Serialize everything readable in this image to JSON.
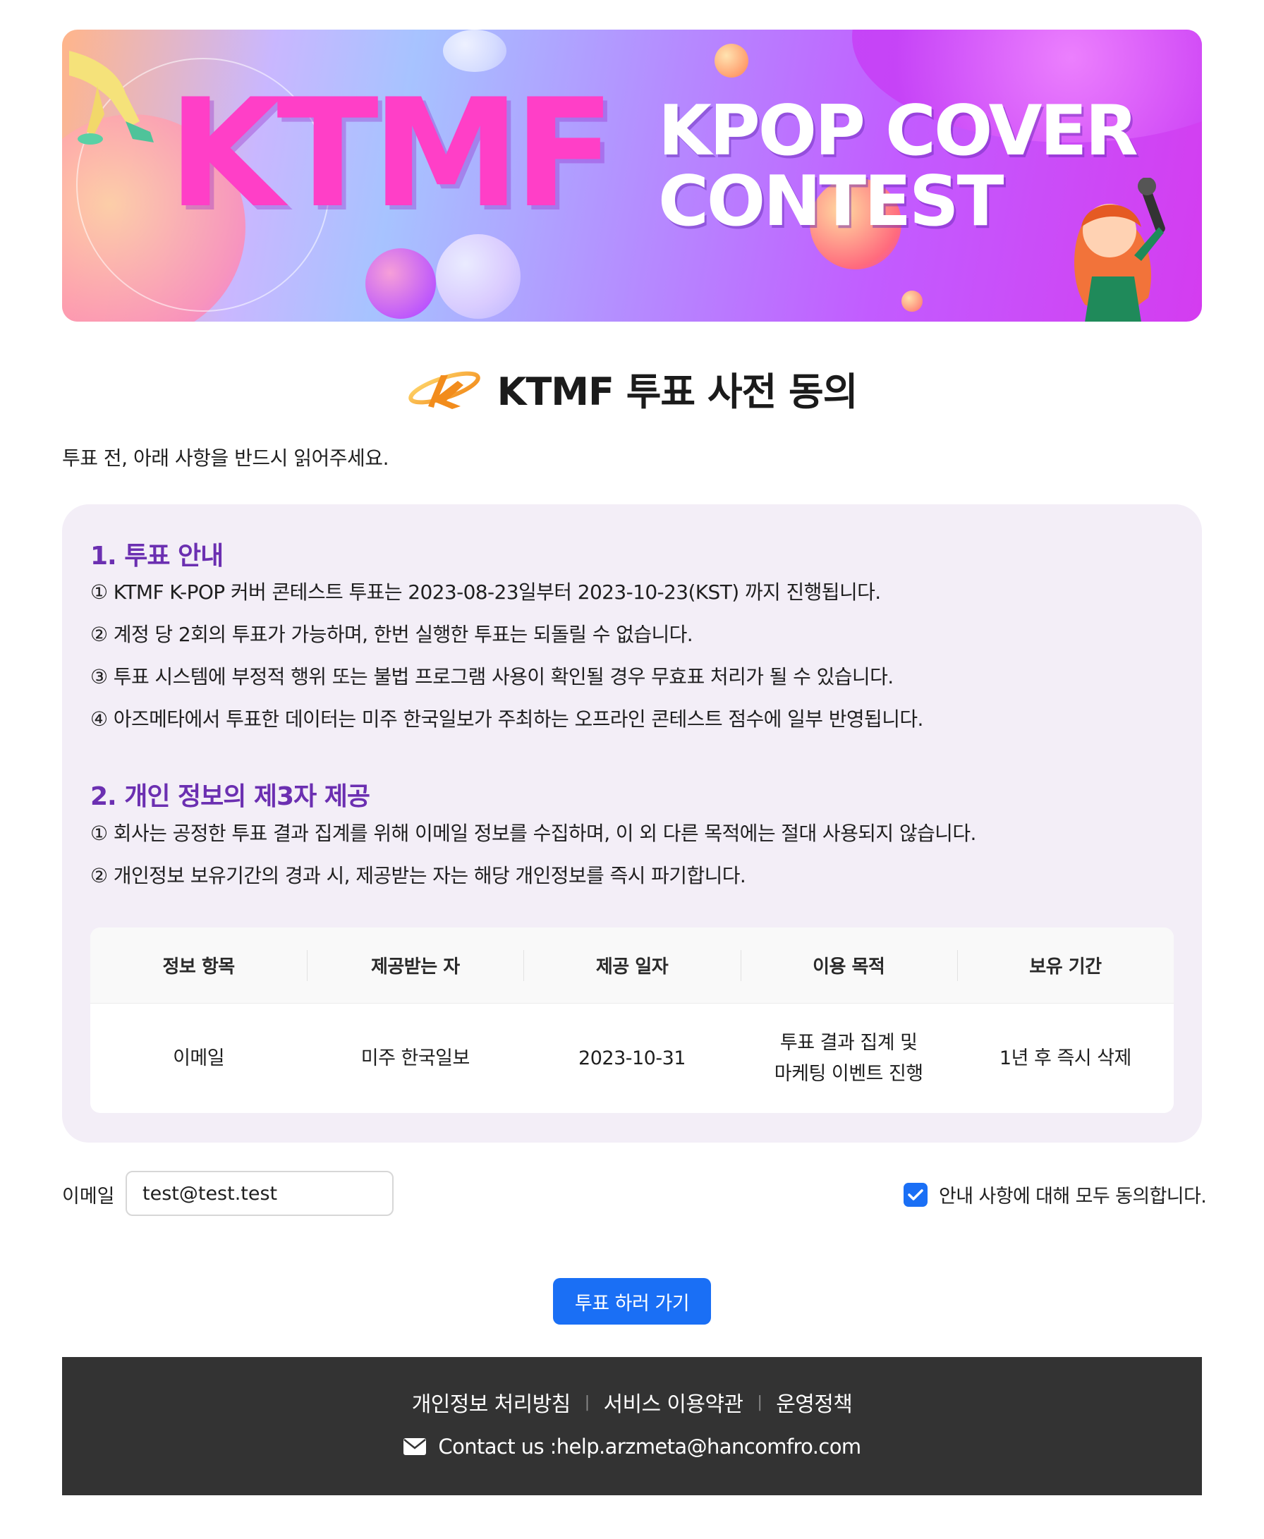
{
  "banner": {
    "logo_text": "KTMF",
    "headline_line1": "KPOP COVER",
    "headline_line2": "CONTEST"
  },
  "page": {
    "title": "KTMF 투표 사전 동의",
    "intro": "투표 전, 아래 사항을 반드시 읽어주세요."
  },
  "section1": {
    "title": "1. 투표 안내",
    "items": [
      "① KTMF K-POP 커버 콘테스트 투표는 2023-08-23일부터 2023-10-23(KST) 까지 진행됩니다.",
      "② 계정 당 2회의 투표가 가능하며, 한번 실행한 투표는 되돌릴 수 없습니다.",
      "③ 투표 시스템에 부정적 행위 또는 불법 프로그램 사용이 확인될 경우 무효표 처리가 될 수 있습니다.",
      "④ 아즈메타에서 투표한 데이터는 미주 한국일보가 주최하는 오프라인 콘테스트 점수에 일부 반영됩니다."
    ]
  },
  "section2": {
    "title": "2. 개인 정보의 제3자 제공",
    "items": [
      "① 회사는 공정한 투표 결과 집계를 위해 이메일 정보를 수집하며, 이 외 다른 목적에는 절대 사용되지 않습니다.",
      "② 개인정보 보유기간의 경과 시, 제공받는 자는 해당 개인정보를 즉시 파기합니다."
    ]
  },
  "table": {
    "headers": [
      "정보 항목",
      "제공받는 자",
      "제공 일자",
      "이용 목적",
      "보유 기간"
    ],
    "row": {
      "item": "이메일",
      "recipient": "미주 한국일보",
      "date": "2023-10-31",
      "purpose_line1": "투표 결과 집계 및",
      "purpose_line2": "마케팅 이벤트 진행",
      "retention": "1년 후 즉시 삭제"
    }
  },
  "form": {
    "email_label": "이메일",
    "email_value": "test@test.test",
    "agree_checked": true,
    "agree_label": "안내 사항에 대해 모두 동의합니다.",
    "submit_label": "투표 하러 가기"
  },
  "footer": {
    "links": [
      "개인정보 처리방침",
      "서비스 이용약관",
      "운영정책"
    ],
    "separator": "|",
    "contact": "Contact us :help.arzmeta@hancomfro.com"
  },
  "colors": {
    "accent": "#1a6ff5",
    "section_title": "#6b2fb1",
    "info_bg": "#f3eef7",
    "footer_bg": "#333333"
  },
  "icons": {
    "title_logo": "ktmf-orbit-logo-icon",
    "checkbox": "check-icon",
    "contact": "envelope-icon"
  }
}
